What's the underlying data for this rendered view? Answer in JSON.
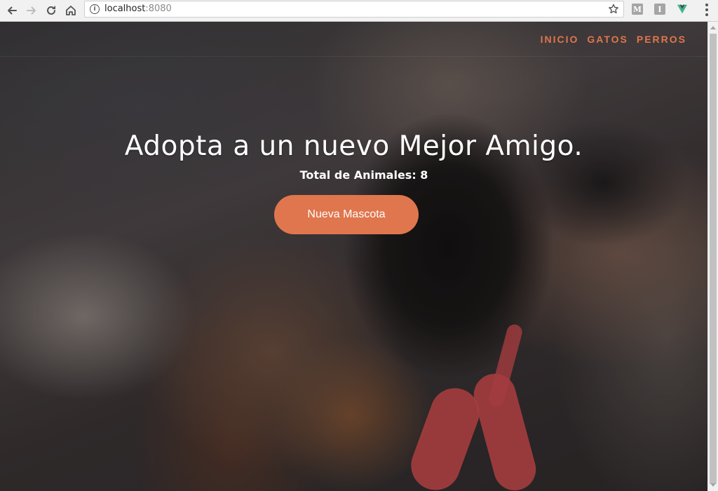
{
  "browser": {
    "url_host": "localhost",
    "url_port": ":8080",
    "extensions": [
      {
        "icon": "metamask-icon",
        "letter": "M",
        "color": "#9c9c9c"
      },
      {
        "icon": "instapaper-icon",
        "letter": "I",
        "color": "#9c9c9c"
      },
      {
        "icon": "vue-devtools-icon",
        "letter": "",
        "color": "#42b883"
      }
    ]
  },
  "nav": {
    "items": [
      {
        "label": "INICIO"
      },
      {
        "label": "GATOS"
      },
      {
        "label": "PERROS"
      }
    ],
    "accent_color": "#e0764d"
  },
  "hero": {
    "title": "Adopta a un nuevo Mejor Amigo.",
    "total_label": "Total de Animales: 8",
    "button_label": "Nueva Mascota",
    "button_color": "#e0764d"
  }
}
